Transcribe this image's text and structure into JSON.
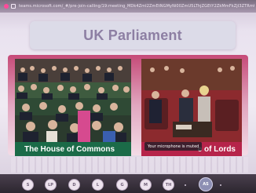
{
  "browser": {
    "url": "teams.microsoft.com/_#/pre-join-calling/19:meeting_MDk4ZmI2ZmEtNGMyNi00ZmU5LThjZGEtY2ZkMmFkZjI3ZTRmQHRocmVhZC52Mg=="
  },
  "slide": {
    "title": "UK Parliament",
    "panels": [
      {
        "caption": "The House of Commons"
      },
      {
        "caption": "e of Lords"
      }
    ],
    "toast": "Your microphone is muted"
  },
  "participants": [
    "S",
    "LP",
    "D",
    "L",
    "G",
    "M",
    "TH"
  ],
  "self_initials": "AS",
  "colors": {
    "commons_green": "#1b6b48",
    "lords_red": "#b6244a",
    "title_text": "#8d7fa3"
  }
}
